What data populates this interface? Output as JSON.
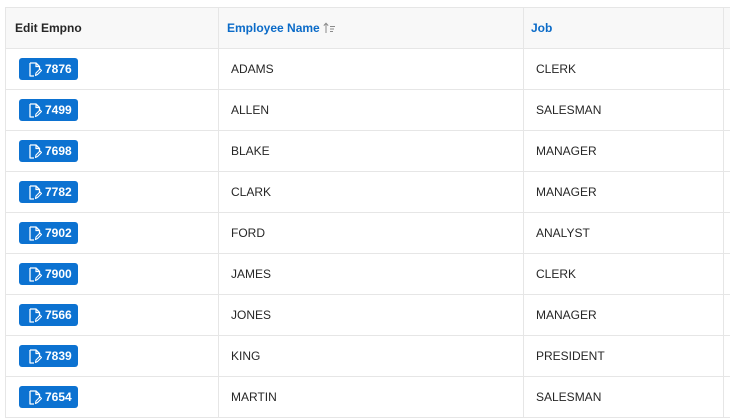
{
  "columns": {
    "edit": "Edit Empno",
    "name": "Employee Name",
    "job": "Job"
  },
  "sort": {
    "column": "name",
    "direction": "ascending",
    "icon": "sort-ascending-icon"
  },
  "accent_color": "#0c72d1",
  "rows": [
    {
      "empno": "7876",
      "name": "ADAMS",
      "job": "CLERK"
    },
    {
      "empno": "7499",
      "name": "ALLEN",
      "job": "SALESMAN"
    },
    {
      "empno": "7698",
      "name": "BLAKE",
      "job": "MANAGER"
    },
    {
      "empno": "7782",
      "name": "CLARK",
      "job": "MANAGER"
    },
    {
      "empno": "7902",
      "name": "FORD",
      "job": "ANALYST"
    },
    {
      "empno": "7900",
      "name": "JAMES",
      "job": "CLERK"
    },
    {
      "empno": "7566",
      "name": "JONES",
      "job": "MANAGER"
    },
    {
      "empno": "7839",
      "name": "KING",
      "job": "PRESIDENT"
    },
    {
      "empno": "7654",
      "name": "MARTIN",
      "job": "SALESMAN"
    }
  ]
}
